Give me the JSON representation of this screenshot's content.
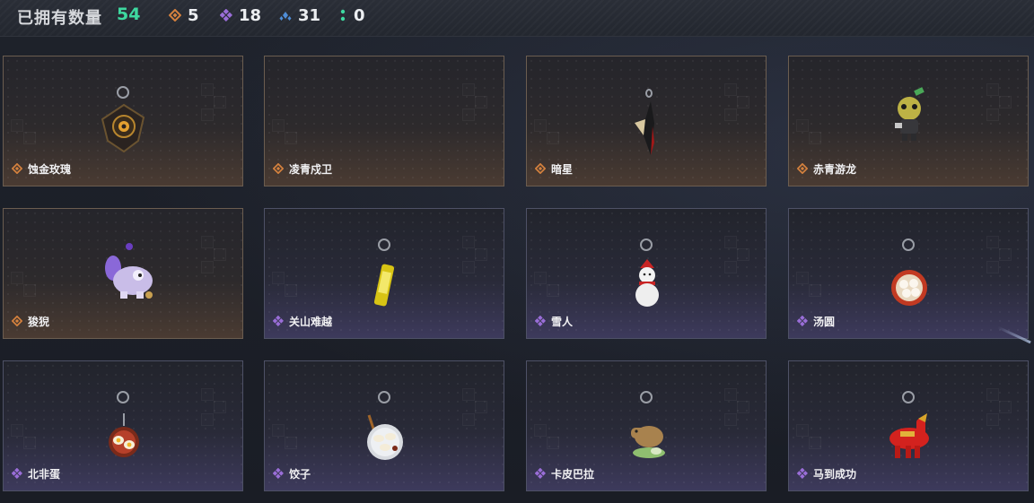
{
  "header": {
    "owned_label": "已拥有数量",
    "owned_count": "54",
    "stats": [
      {
        "icon": "orange-diamond-icon",
        "color": "#d4813e",
        "value": "5"
      },
      {
        "icon": "purple-diamond-icon",
        "color": "#9a6ed8",
        "value": "18"
      },
      {
        "icon": "blue-triangle-icon",
        "color": "#4f8ed8",
        "value": "31"
      },
      {
        "icon": "green-dots-icon",
        "color": "#3ed9a0",
        "value": "0"
      }
    ]
  },
  "items": [
    {
      "name": "蚀金玫瑰",
      "rarity": "orange",
      "art": "gold-rose-pendant"
    },
    {
      "name": "凌青戍卫",
      "rarity": "orange",
      "art": "none"
    },
    {
      "name": "暗星",
      "rarity": "orange",
      "art": "dark-star-blade-pendant"
    },
    {
      "name": "赤青游龙",
      "rarity": "orange",
      "art": "dragon-figure-pendant"
    },
    {
      "name": "狻猊",
      "rarity": "orange",
      "art": "purple-lion-pendant"
    },
    {
      "name": "关山难越",
      "rarity": "purple",
      "art": "yellow-can-pendant"
    },
    {
      "name": "雪人",
      "rarity": "purple",
      "art": "snowman-pendant"
    },
    {
      "name": "汤圆",
      "rarity": "purple",
      "art": "tangyuan-bowl-pendant"
    },
    {
      "name": "北非蛋",
      "rarity": "purple",
      "art": "shakshuka-pan-pendant"
    },
    {
      "name": "饺子",
      "rarity": "purple",
      "art": "dumpling-plate-pendant"
    },
    {
      "name": "卡皮巴拉",
      "rarity": "purple",
      "art": "capybara-pendant"
    },
    {
      "name": "马到成功",
      "rarity": "purple",
      "art": "red-horse-pendant"
    }
  ],
  "colors": {
    "orange_accent": "#d4813e",
    "purple_accent": "#9a6ed8",
    "count_green": "#3ed9a0"
  }
}
